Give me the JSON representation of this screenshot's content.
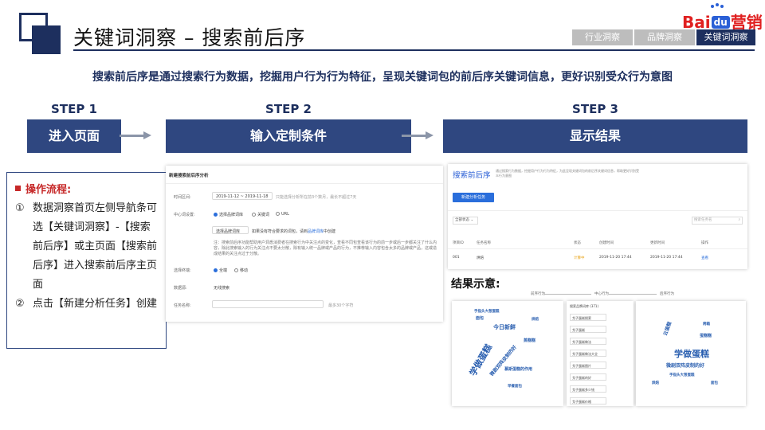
{
  "header": {
    "title": "关键词洞察 – 搜索前后序",
    "logo": {
      "bai": "Bai",
      "du": "du",
      "brand": "营销"
    },
    "tabs": [
      {
        "label": "行业洞察",
        "active": false
      },
      {
        "label": "品牌洞察",
        "active": false
      },
      {
        "label": "关键词洞察",
        "active": true
      }
    ]
  },
  "subtitle": "搜索前后序是通过搜索行为数据，挖掘用户行为行为特征，呈现关键词包的前后序关键词信息，更好识别受众行为意图",
  "steps": [
    {
      "step": "STEP 1",
      "label": "进入页面"
    },
    {
      "step": "STEP 2",
      "label": "输入定制条件"
    },
    {
      "step": "STEP 3",
      "label": "显示结果"
    }
  ],
  "process": {
    "heading": "操作流程:",
    "items": [
      {
        "num": "①",
        "text": "数据洞察首页左侧导航条可选【关键词洞察】-【搜索前后序】或主页面【搜索前后序】进入搜索前后序主页面"
      },
      {
        "num": "②",
        "text": "点击【新建分析任务】创建"
      }
    ]
  },
  "form_screenshot": {
    "title": "新建搜索前后序分析",
    "time_label": "时间区间:",
    "time_value": "2019-11-12 ~ 2019-11-18",
    "time_hint": "只能选择分析所在前3个数月，最长不超过7天",
    "center_label": "中心词设置:",
    "center_options": [
      "选择品牌词库",
      "关键词",
      "URL"
    ],
    "brand_select": "选择品牌词库",
    "brand_hint": "如果没有符合要求的词包，请到",
    "brand_link": "品牌词库",
    "brand_hint_tail": "中创建",
    "note": "注：搜索前后序功能帮助用户洞悉消费者在搜索行为中关注点的变化，查看不同包查看该行为的前一步或后一步都关注了什么内容，除此搜索输入的行为关注点不要太分散，除有输入统一品牌或产品的行为，不推荐输入内容包含太多的品牌或产品，这或造成结果的关注点过于分散。",
    "terminal_label": "选择终端:",
    "terminal_options": [
      "全端",
      "移动"
    ],
    "source_label": "数据源:",
    "source_value": "无线搜索",
    "task_label": "任务名称:",
    "task_hint": "最多30个字符"
  },
  "list_screenshot": {
    "title": "搜索前后序",
    "desc": "通过搜索行为数据，挖掘用户行为行为特征，为此呈现关键词包的前后序关键词信息，帮助更好识别受众行为意图",
    "new_button": "新建分析任务",
    "filter": "全部状态",
    "search_placeholder": "搜索任务名",
    "columns": [
      "项目ID",
      "任务名称",
      "状态",
      "创建时间",
      "更新时间",
      "操作"
    ],
    "row": {
      "id": "001",
      "name": "烘焙",
      "status": "计算中",
      "created": "2019-11-20 17:44",
      "updated": "2019-11-20 17:44",
      "action": "查看"
    }
  },
  "result": {
    "label": "结果示意:",
    "flow": [
      "前序行为",
      "中心行为",
      "后序行为"
    ],
    "mid_title": "搜索品牌词库 (371)",
    "mid_rows": [
      "戈子蛋糕搜索",
      "戈子蛋糕",
      "戈子蛋糕做法",
      "戈子蛋糕做法大全",
      "戈子蛋糕图片",
      "戈子蛋糕的好",
      "戈子蛋糕多少钱",
      "戈子蛋糕价格"
    ],
    "cloud_left": [
      "学做蛋糕",
      "今日新鲜",
      "微剧双阵皮制的好",
      "蒸糕糕",
      "面包",
      "慕斯蛋糕的作用",
      "早餐面包",
      "手指头大葱蛋糕",
      "烘焙"
    ],
    "cloud_right": [
      "学做蛋糕",
      "微剧双阵皮制的好",
      "云蛋糕",
      "蛋糕糕",
      "手指头大葱蛋糕",
      "烤箱",
      "面包",
      "烘焙"
    ]
  },
  "colors": {
    "navy": "#1d2f5e",
    "step_box": "#2f4780",
    "accent_red": "#c62828",
    "link_blue": "#2a6edb"
  }
}
